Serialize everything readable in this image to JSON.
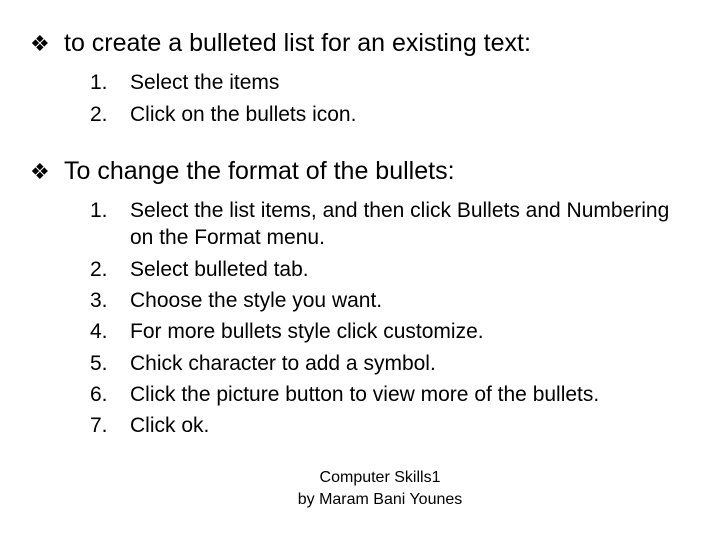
{
  "sections": [
    {
      "heading": "to create a bulleted list for an existing text:",
      "items": [
        "Select the items",
        "Click on the bullets icon."
      ]
    },
    {
      "heading": "To change the format of the bullets:",
      "items": [
        "Select the list items, and then click Bullets and Numbering on the Format menu.",
        "Select bulleted tab.",
        "Choose the style you want.",
        "For more bullets style click customize.",
        "Chick character to add a symbol.",
        "Click the picture button to view more of the bullets.",
        "Click ok."
      ]
    }
  ],
  "footer": {
    "line1": "Computer Skills1",
    "line2": "by Maram Bani Younes"
  },
  "glyphs": {
    "diamond_bullet": "❖"
  }
}
